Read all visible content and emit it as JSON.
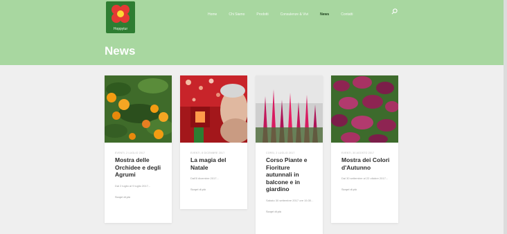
{
  "logo": {
    "text": "Hoppytur"
  },
  "nav": {
    "items": [
      {
        "label": "Home",
        "active": false
      },
      {
        "label": "Chi Siamo",
        "active": false
      },
      {
        "label": "Prodotti",
        "active": false
      },
      {
        "label": "Consulenze & Vivi",
        "active": false
      },
      {
        "label": "News",
        "active": true
      },
      {
        "label": "Contatti",
        "active": false
      }
    ]
  },
  "page": {
    "title": "News"
  },
  "cards": [
    {
      "meta": "EVENTI, 2 LUGLIO 2017",
      "title": "Mostra delle Orchidee e degli Agrumi",
      "excerpt": "Dal 2 luglio al 9 luglio 2017...",
      "more": "Scopri di più"
    },
    {
      "meta": "EVENTI, 8 DICEMBRE 2017",
      "title": "La magia del Natale",
      "excerpt": "Dall'8 dicembre 2017...",
      "more": "Scopri di più"
    },
    {
      "meta": "CORSI, 2 LUGLIO 2017",
      "title": "Corso Piante e Fioriture autunnali in balcone e in giardino",
      "excerpt": "Sabato 30 settembre 2017 ore 15:30...",
      "more": "Scopri di più"
    },
    {
      "meta": "EVENTI, 30 AGOSTO 2017",
      "title": "Mostra dei Colori d'Autunno",
      "excerpt": "Dal 30 settembre al 22 ottobre 2017...",
      "more": "Scopri di più"
    }
  ],
  "colors": {
    "header": "#a8d7a0",
    "background": "#efefef",
    "card": "#ffffff",
    "active_nav": "#1a3d1a"
  }
}
